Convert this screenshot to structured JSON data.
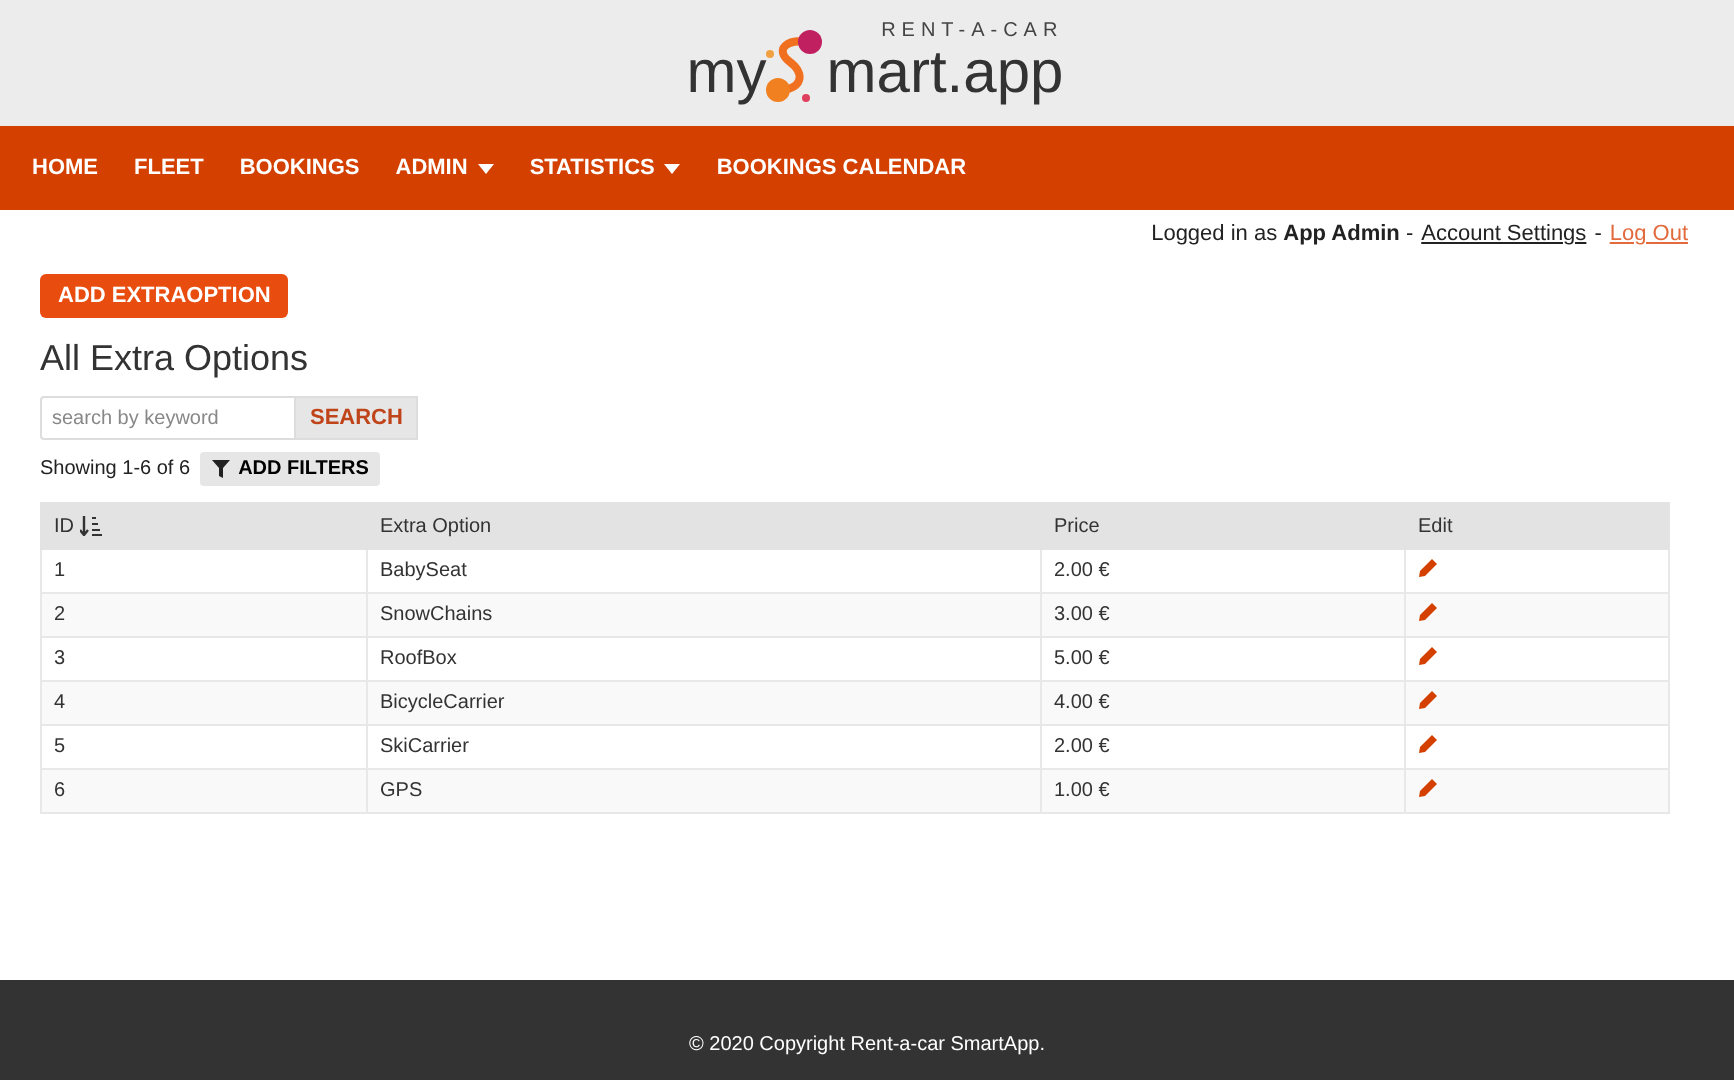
{
  "logo": {
    "tagline": "RENT-A-CAR",
    "left": "my",
    "right": "mart.app"
  },
  "nav": [
    {
      "label": "HOME",
      "dropdown": false
    },
    {
      "label": "FLEET",
      "dropdown": false
    },
    {
      "label": "BOOKINGS",
      "dropdown": false
    },
    {
      "label": "ADMIN",
      "dropdown": true
    },
    {
      "label": "STATISTICS",
      "dropdown": true
    },
    {
      "label": "BOOKINGS CALENDAR",
      "dropdown": false
    }
  ],
  "user_bar": {
    "prefix": "Logged in as",
    "user": "App Admin",
    "sep1": "-",
    "settings": "Account Settings",
    "sep2": "-",
    "logout": "Log Out"
  },
  "add_button": "ADD EXTRAOPTION",
  "title": "All Extra Options",
  "search": {
    "placeholder": "search by keyword",
    "button": "SEARCH"
  },
  "showing": "Showing 1-6 of 6",
  "filters_button": "ADD FILTERS",
  "table": {
    "columns": [
      {
        "label": "ID",
        "sorted": true
      },
      {
        "label": "Extra Option",
        "sorted": false
      },
      {
        "label": "Price",
        "sorted": false
      },
      {
        "label": "Edit",
        "sorted": false
      }
    ],
    "rows": [
      {
        "id": "1",
        "name": "BabySeat",
        "price": "2.00 €"
      },
      {
        "id": "2",
        "name": "SnowChains",
        "price": "3.00 €"
      },
      {
        "id": "3",
        "name": "RoofBox",
        "price": "5.00 €"
      },
      {
        "id": "4",
        "name": "BicycleCarrier",
        "price": "4.00 €"
      },
      {
        "id": "5",
        "name": "SkiCarrier",
        "price": "2.00 €"
      },
      {
        "id": "6",
        "name": "GPS",
        "price": "1.00 €"
      }
    ]
  },
  "footer": "© 2020 Copyright Rent-a-car SmartApp."
}
